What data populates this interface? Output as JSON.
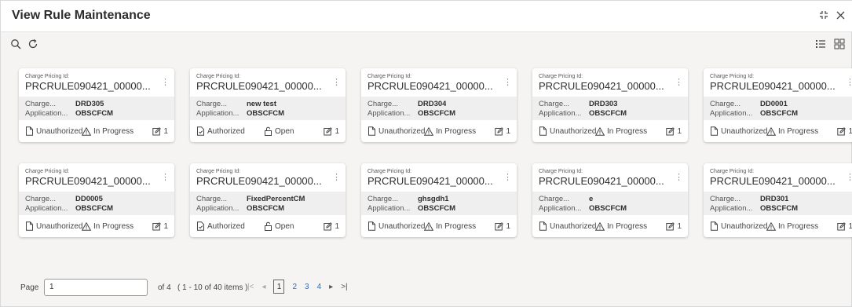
{
  "window": {
    "title": "View Rule Maintenance"
  },
  "cards": [
    {
      "id_label": "Charge Pricing Id:",
      "id_value": "PRCRULE090421_00000...",
      "k1": "Charge...",
      "v1": "DRD305",
      "k2": "Application...",
      "v2": "OBSCFCM",
      "auth": "Unauthorized",
      "status": "In Progress",
      "count": "1",
      "auth_icon": "document-icon",
      "status_icon": "warning-icon"
    },
    {
      "id_label": "Charge Pricing Id:",
      "id_value": "PRCRULE090421_00000...",
      "k1": "Charge...",
      "v1": "new test",
      "k2": "Application...",
      "v2": "OBSCFCM",
      "auth": "Authorized",
      "status": "Open",
      "count": "1",
      "auth_icon": "document-check-icon",
      "status_icon": "unlock-icon"
    },
    {
      "id_label": "Charge Pricing Id:",
      "id_value": "PRCRULE090421_00000...",
      "k1": "Charge...",
      "v1": "DRD304",
      "k2": "Application...",
      "v2": "OBSCFCM",
      "auth": "Unauthorized",
      "status": "In Progress",
      "count": "1",
      "auth_icon": "document-icon",
      "status_icon": "warning-icon"
    },
    {
      "id_label": "Charge Pricing Id:",
      "id_value": "PRCRULE090421_00000...",
      "k1": "Charge...",
      "v1": "DRD303",
      "k2": "Application...",
      "v2": "OBSCFCM",
      "auth": "Unauthorized",
      "status": "In Progress",
      "count": "1",
      "auth_icon": "document-icon",
      "status_icon": "warning-icon"
    },
    {
      "id_label": "Charge Pricing Id:",
      "id_value": "PRCRULE090421_00000...",
      "k1": "Charge...",
      "v1": "DD0001",
      "k2": "Application...",
      "v2": "OBSCFCM",
      "auth": "Unauthorized",
      "status": "In Progress",
      "count": "1",
      "auth_icon": "document-icon",
      "status_icon": "warning-icon"
    },
    {
      "id_label": "Charge Pricing Id:",
      "id_value": "PRCRULE090421_00000...",
      "k1": "Charge...",
      "v1": "DD0005",
      "k2": "Application...",
      "v2": "OBSCFCM",
      "auth": "Unauthorized",
      "status": "In Progress",
      "count": "1",
      "auth_icon": "document-icon",
      "status_icon": "warning-icon"
    },
    {
      "id_label": "Charge Pricing Id:",
      "id_value": "PRCRULE090421_00000...",
      "k1": "Charge...",
      "v1": "FixedPercentCM",
      "k2": "Application...",
      "v2": "OBSCFCM",
      "auth": "Authorized",
      "status": "Open",
      "count": "1",
      "auth_icon": "document-check-icon",
      "status_icon": "unlock-icon"
    },
    {
      "id_label": "Charge Pricing Id:",
      "id_value": "PRCRULE090421_00000...",
      "k1": "Charge...",
      "v1": "ghsgdh1",
      "k2": "Application...",
      "v2": "OBSCFCM",
      "auth": "Unauthorized",
      "status": "In Progress",
      "count": "1",
      "auth_icon": "document-icon",
      "status_icon": "warning-icon"
    },
    {
      "id_label": "Charge Pricing Id:",
      "id_value": "PRCRULE090421_00000...",
      "k1": "Charge...",
      "v1": "e",
      "k2": "Application...",
      "v2": "OBSCFCM",
      "auth": "Unauthorized",
      "status": "In Progress",
      "count": "1",
      "auth_icon": "document-icon",
      "status_icon": "warning-icon"
    },
    {
      "id_label": "Charge Pricing Id:",
      "id_value": "PRCRULE090421_00000...",
      "k1": "Charge...",
      "v1": "DRD301",
      "k2": "Application...",
      "v2": "OBSCFCM",
      "auth": "Unauthorized",
      "status": "In Progress",
      "count": "1",
      "auth_icon": "document-icon",
      "status_icon": "warning-icon"
    }
  ],
  "pager": {
    "label": "Page",
    "value": "1",
    "of_text": "of 4",
    "items_text": "( 1 - 10 of 40 items )",
    "pages": [
      "1",
      "2",
      "3",
      "4"
    ],
    "current": "1"
  },
  "colors": {
    "link": "#2a6ec0",
    "card_body_bg": "#efefef",
    "page_bg": "#f5f4f2"
  }
}
